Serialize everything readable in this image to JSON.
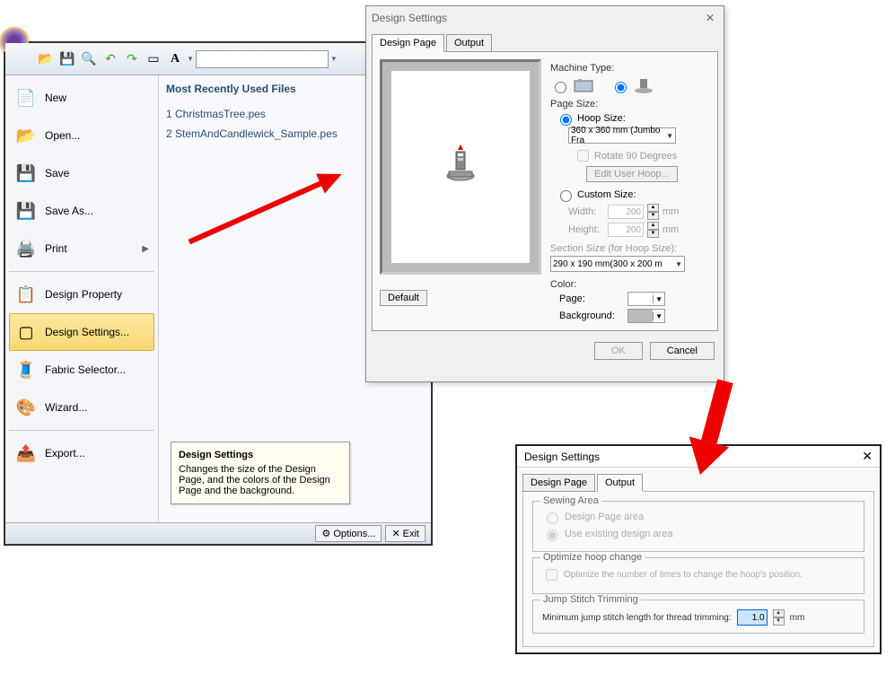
{
  "toolbar": {
    "font_size_placeholder": ""
  },
  "menu": {
    "new": "New",
    "open": "Open...",
    "save": "Save",
    "save_as": "Save As...",
    "print": "Print",
    "design_property": "Design Property",
    "design_settings": "Design Settings...",
    "fabric_selector": "Fabric Selector...",
    "wizard": "Wizard...",
    "export": "Export..."
  },
  "recent": {
    "title": "Most Recently Used Files",
    "items": [
      "1 ChristmasTree.pes",
      "2 StemAndCandlewick_Sample.pes"
    ]
  },
  "tooltip": {
    "title": "Design Settings",
    "body": "Changes the size of the Design Page, and the colors of the Design Page and the background."
  },
  "bottom": {
    "options": "Options...",
    "exit": "Exit"
  },
  "dialog1": {
    "title": "Design Settings",
    "tab_design": "Design Page",
    "tab_output": "Output",
    "machine_type": "Machine Type:",
    "page_size": "Page Size:",
    "hoop_size": "Hoop Size:",
    "hoop_value": "360 x 360 mm (Jumbo Fra",
    "rotate90": "Rotate 90 Degrees",
    "edit_hoop": "Edit User Hoop...",
    "custom_size": "Custom Size:",
    "width_label": "Width:",
    "height_label": "Height:",
    "width_val": "200",
    "height_val": "200",
    "mm": "mm",
    "section_size": "Section Size (for Hoop Size):",
    "section_val": "290 x 190 mm(300 x 200 m",
    "color_label": "Color:",
    "page_label": "Page:",
    "background_label": "Background:",
    "default_btn": "Default",
    "ok": "OK",
    "cancel": "Cancel"
  },
  "dialog2": {
    "title": "Design Settings",
    "tab_design": "Design Page",
    "tab_output": "Output",
    "sewing_area": "Sewing Area",
    "design_page_area": "Design Page area",
    "use_existing": "Use existing design area",
    "optimize_hoop": "Optimize hoop change",
    "optimize_text": "Optimize the number of times to change the hoop's position.",
    "jump_stitch": "Jump Stitch Trimming",
    "jump_label": "Minimum jump stitch length for thread trimming:",
    "jump_val": "1.0",
    "mm": "mm"
  }
}
